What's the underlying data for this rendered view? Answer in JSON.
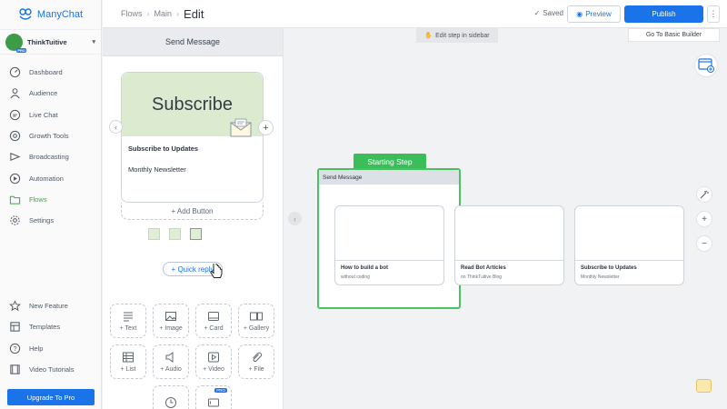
{
  "brand": {
    "name": "ManyChat"
  },
  "account": {
    "name": "ThinkTuitive"
  },
  "sidebar": {
    "items": [
      {
        "label": "Dashboard",
        "icon": "dashboard-icon"
      },
      {
        "label": "Audience",
        "icon": "audience-icon"
      },
      {
        "label": "Live Chat",
        "icon": "live-chat-icon"
      },
      {
        "label": "Growth Tools",
        "icon": "growth-tools-icon"
      },
      {
        "label": "Broadcasting",
        "icon": "broadcasting-icon"
      },
      {
        "label": "Automation",
        "icon": "automation-icon"
      },
      {
        "label": "Flows",
        "icon": "flows-icon",
        "active": true
      },
      {
        "label": "Settings",
        "icon": "settings-icon"
      }
    ],
    "bottom_items": [
      {
        "label": "New Feature",
        "icon": "star-icon"
      },
      {
        "label": "Templates",
        "icon": "templates-icon"
      },
      {
        "label": "Help",
        "icon": "help-icon"
      },
      {
        "label": "Video Tutorials",
        "icon": "video-tutorials-icon"
      }
    ],
    "upgrade_label": "Upgrade To Pro"
  },
  "topbar": {
    "breadcrumbs": [
      "Flows",
      "Main"
    ],
    "current": "Edit",
    "saved": "Saved",
    "preview": "Preview",
    "publish": "Publish"
  },
  "panel": {
    "title": "Send Message",
    "card": {
      "image_text": "Subscribe",
      "title": "Subscribe to Updates",
      "subtitle": "Monthly Newsletter"
    },
    "add_button": "+ Add Button",
    "thumbs": [
      "",
      "",
      ""
    ],
    "quick_reply": "+ Quick reply",
    "tools": [
      "+ Text",
      "+ Image",
      "+ Card",
      "+ Gallery",
      "+ List",
      "+ Audio",
      "+ Video",
      "+ File"
    ],
    "pro_badge": "PRO"
  },
  "canvas": {
    "hint": "Edit step in sidebar",
    "basic_builder": "Go To Basic Builder",
    "start_tag": "Starting Step",
    "node_title": "Send Message",
    "cards": [
      {
        "title": "How to build a bot",
        "subtitle": "without coding"
      },
      {
        "title": "Read Bot Articles",
        "subtitle": "on ThinkTuitive Blog"
      },
      {
        "title": "Subscribe to Updates",
        "subtitle": "Monthly Newsletter"
      }
    ]
  },
  "colors": {
    "accent": "#1a73e8",
    "active": "#3fa64b",
    "start": "#3bbd5a"
  }
}
